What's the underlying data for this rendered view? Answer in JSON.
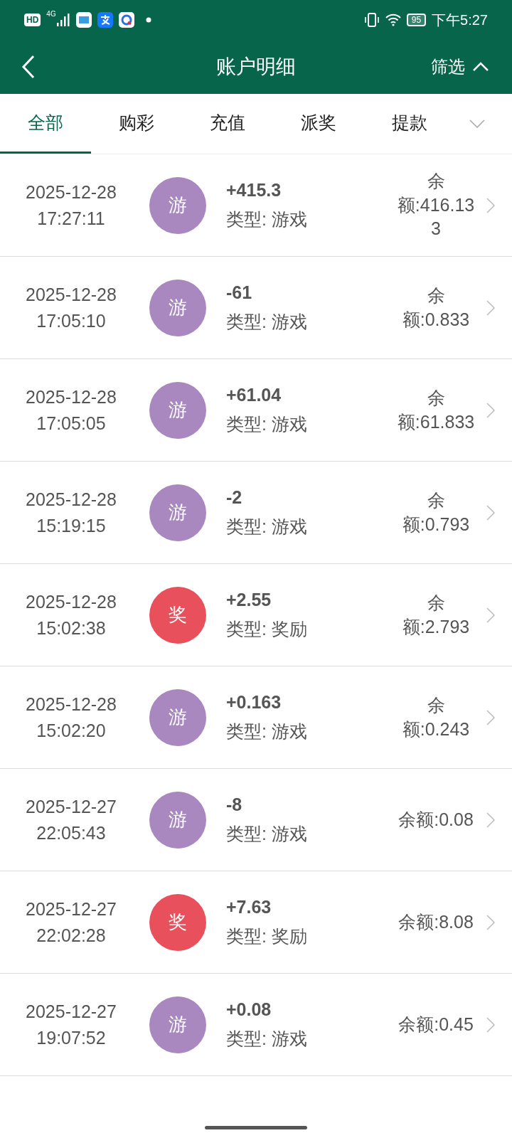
{
  "status_bar": {
    "hd": "HD",
    "network": "4G",
    "battery": "95",
    "time": "下午5:27"
  },
  "nav": {
    "title": "账户明细",
    "filter": "筛选"
  },
  "tabs": [
    {
      "label": "全部",
      "selected": true
    },
    {
      "label": "购彩",
      "selected": false
    },
    {
      "label": "充值",
      "selected": false
    },
    {
      "label": "派奖",
      "selected": false
    },
    {
      "label": "提款",
      "selected": false
    }
  ],
  "records": [
    {
      "date": "2025-12-28",
      "time": "17:27:11",
      "badge": "游",
      "color": "#a988bf",
      "amount": "+415.3",
      "type": "类型: 游戏",
      "balance": "余额:416.133"
    },
    {
      "date": "2025-12-28",
      "time": "17:05:10",
      "badge": "游",
      "color": "#a988bf",
      "amount": "-61",
      "type": "类型: 游戏",
      "balance": "余额:0.833"
    },
    {
      "date": "2025-12-28",
      "time": "17:05:05",
      "badge": "游",
      "color": "#a988bf",
      "amount": "+61.04",
      "type": "类型: 游戏",
      "balance": "余额:61.833"
    },
    {
      "date": "2025-12-28",
      "time": "15:19:15",
      "badge": "游",
      "color": "#a988bf",
      "amount": "-2",
      "type": "类型: 游戏",
      "balance": "余额:0.793"
    },
    {
      "date": "2025-12-28",
      "time": "15:02:38",
      "badge": "奖",
      "color": "#e8505b",
      "amount": "+2.55",
      "type": "类型: 奖励",
      "balance": "余额:2.793"
    },
    {
      "date": "2025-12-28",
      "time": "15:02:20",
      "badge": "游",
      "color": "#a988bf",
      "amount": "+0.163",
      "type": "类型: 游戏",
      "balance": "余额:0.243"
    },
    {
      "date": "2025-12-27",
      "time": "22:05:43",
      "badge": "游",
      "color": "#a988bf",
      "amount": "-8",
      "type": "类型: 游戏",
      "balance": "余额:0.08"
    },
    {
      "date": "2025-12-27",
      "time": "22:02:28",
      "badge": "奖",
      "color": "#e8505b",
      "amount": "+7.63",
      "type": "类型: 奖励",
      "balance": "余额:8.08"
    },
    {
      "date": "2025-12-27",
      "time": "19:07:52",
      "badge": "游",
      "color": "#a988bf",
      "amount": "+0.08",
      "type": "类型: 游戏",
      "balance": "余额:0.45"
    }
  ]
}
